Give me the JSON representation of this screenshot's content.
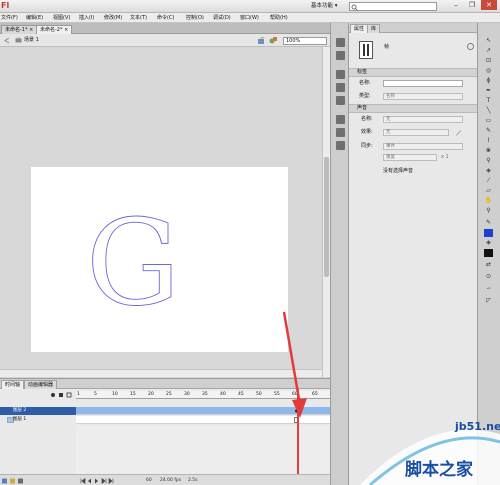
{
  "titlebar": {
    "logo": "Fl",
    "workspace": "基本功能 ▾",
    "search_placeholder": "",
    "minimize": "–",
    "restore": "❐",
    "close": "✕"
  },
  "menu": [
    "文件(F)",
    "编辑(E)",
    "视图(V)",
    "插入(I)",
    "修改(M)",
    "文本(T)",
    "命令(C)",
    "控制(O)",
    "调试(D)",
    "窗口(W)",
    "帮助(H)"
  ],
  "doc_tabs": [
    "未命名-1* ×",
    "未命名-2* ×"
  ],
  "scene": {
    "label": "场景 1",
    "zoom": "100%"
  },
  "stage": {
    "glyph": "G",
    "glyph_color": "#6a6ad6"
  },
  "timeline": {
    "tabs": [
      "时间轴",
      "动画编辑器"
    ],
    "ruler": [
      "1",
      "5",
      "10",
      "15",
      "20",
      "25",
      "30",
      "35",
      "40",
      "45",
      "50",
      "55",
      "60",
      "65"
    ],
    "layers": [
      {
        "name": "图层 2"
      },
      {
        "name": "图层 1"
      }
    ],
    "status": {
      "frame": "60",
      "fps": "24.00 fps",
      "time": "2.5s"
    }
  },
  "properties": {
    "tabs": [
      "属性",
      "库"
    ],
    "frame_label": "帧",
    "label_section": "标签",
    "name_label": "名称:",
    "type_label": "类型:",
    "type_value": "名称",
    "sound_section": "声音",
    "sound_name_label": "名称:",
    "sound_name_value": "无",
    "effect_label": "效果:",
    "effect_value": "无",
    "sync_label": "同步:",
    "sync_value": "事件",
    "repeat_value": "重复",
    "repeat_count": "x 1",
    "no_sound": "没有选择声音"
  },
  "watermark": {
    "url": "jb51.net",
    "text": "脚本之家"
  }
}
